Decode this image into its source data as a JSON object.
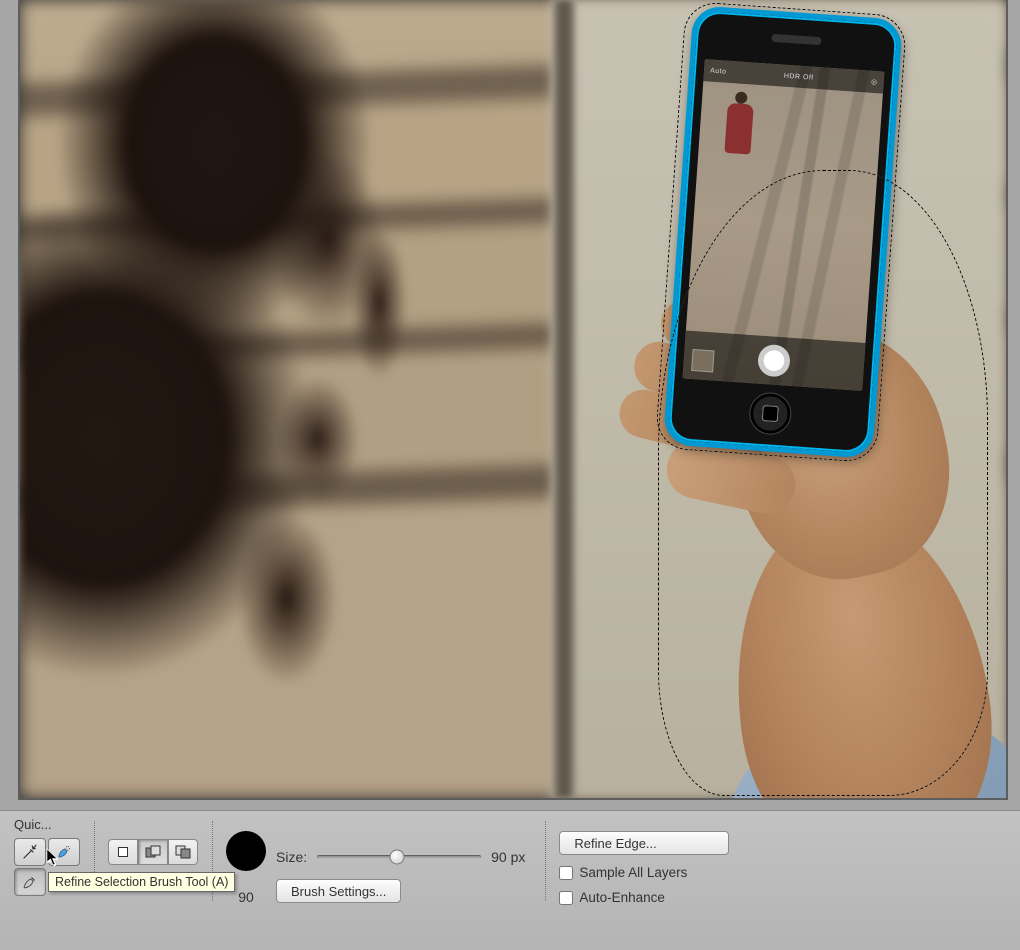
{
  "panel": {
    "title": "Quic..."
  },
  "tooltip": "Refine Selection Brush Tool (A)",
  "mode": {
    "label": "Add"
  },
  "brush": {
    "size_label": "Size:",
    "size_text": "90 px",
    "size_value": "90",
    "settings_label": "Brush Settings..."
  },
  "refine": {
    "edge_label": "Refine Edge...",
    "sample_label": "Sample All Layers",
    "auto_label": "Auto-Enhance"
  },
  "phone_ui": {
    "flash": "Auto",
    "hdr": "HDR Off"
  }
}
